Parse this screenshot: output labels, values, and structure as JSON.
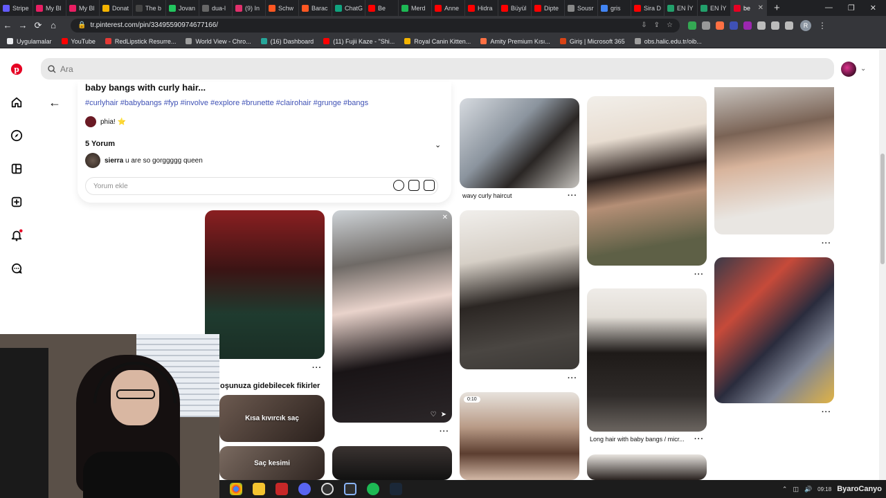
{
  "browser": {
    "tabs": [
      {
        "label": "Stripe",
        "color": "#635bff"
      },
      {
        "label": "My Bl",
        "color": "#e91e63"
      },
      {
        "label": "My Bl",
        "color": "#e91e63"
      },
      {
        "label": "Donat",
        "color": "#f4b400"
      },
      {
        "label": "The b",
        "color": "#444444"
      },
      {
        "label": "Jovan",
        "color": "#22c55e"
      },
      {
        "label": "dua-l",
        "color": "#666666"
      },
      {
        "label": "(9) In",
        "color": "#e1306c"
      },
      {
        "label": "Schw",
        "color": "#ff5722"
      },
      {
        "label": "Barac",
        "color": "#ff5722"
      },
      {
        "label": "ChatG",
        "color": "#10a37f"
      },
      {
        "label": "Be",
        "color": "#ff0000"
      },
      {
        "label": "Merd",
        "color": "#1db954"
      },
      {
        "label": "Anne",
        "color": "#ff0000"
      },
      {
        "label": "Hidra",
        "color": "#ff0000"
      },
      {
        "label": "Büyül",
        "color": "#ff0000"
      },
      {
        "label": "Dipte",
        "color": "#ff0000"
      },
      {
        "label": "Sousr",
        "color": "#888888"
      },
      {
        "label": "gris",
        "color": "#4285f4"
      },
      {
        "label": "Sira D",
        "color": "#ff0000"
      },
      {
        "label": "EN İY",
        "color": "#22a06b"
      },
      {
        "label": "EN İY",
        "color": "#22a06b"
      },
      {
        "label": "be",
        "color": "#e60023",
        "active": true
      }
    ],
    "new_tab": "+",
    "url": "tr.pinterest.com/pin/33495590974677166/",
    "bookmarks": [
      {
        "label": "Uygulamalar",
        "color": "#e8eaed"
      },
      {
        "label": "YouTube",
        "color": "#ff0000"
      },
      {
        "label": "RedLipstick Resurre...",
        "color": "#e53935"
      },
      {
        "label": "World View - Chro...",
        "color": "#9e9e9e"
      },
      {
        "label": "(16) Dashboard",
        "color": "#26a69a"
      },
      {
        "label": "(11) Fujii Kaze - \"Shi...",
        "color": "#ff0000"
      },
      {
        "label": "Royal Canin Kitten...",
        "color": "#f4b400"
      },
      {
        "label": "Amity Premium Kısı...",
        "color": "#ff7043"
      },
      {
        "label": "Giriş | Microsoft 365",
        "color": "#d84315"
      },
      {
        "label": "obs.halic.edu.tr/oib...",
        "color": "#9e9e9e"
      }
    ],
    "profile_initial": "R"
  },
  "search": {
    "placeholder": "Ara"
  },
  "pin": {
    "title": "baby bangs with curly hair...",
    "hashtags": "#curlyhair #babybangs #fyp #involve #explore #brunette #clairohair #grunge #bangs",
    "author": "phia! ⭐",
    "comments_header": "5 Yorum",
    "comment_user": "sierra",
    "comment_text": "u are so gorggggg queen",
    "add_comment_placeholder": "Yorum ekle"
  },
  "grid": {
    "labels": {
      "wavy": "wavy curly haircut",
      "long": "Long hair with baby bangs / micr...",
      "more_dots": "···"
    },
    "section_title": "oşunuza gidebilecek fikirler",
    "overlay_kisa": "Kısa kıvırcık saç",
    "overlay_sac": "Saç kesimi",
    "video_time": "0:10"
  },
  "taskbar": {
    "clock_time": "09:18",
    "watermark": "ByaroCanyo"
  },
  "colors": {
    "pinterest_red": "#e60023",
    "hashtag_blue": "#3f51b5",
    "chrome_dark": "#202124",
    "chrome_toolbar": "#35363a"
  }
}
